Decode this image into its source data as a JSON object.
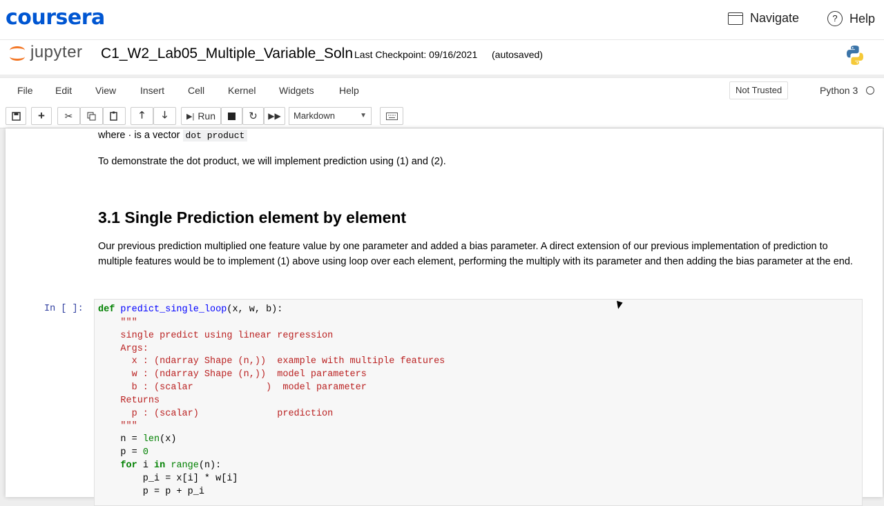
{
  "coursera": {
    "logo": "coursera",
    "navigate_label": "Navigate",
    "help_label": "Help",
    "navigate_icon": "window-icon",
    "help_icon": "question-circle-icon",
    "brand_color": "#0056d2"
  },
  "jupyter": {
    "logo_text": "jupyter",
    "notebook_title": "C1_W2_Lab05_Multiple_Variable_Soln",
    "checkpoint": "Last Checkpoint: 09/16/2021",
    "autosaved": "(autosaved)",
    "logo_color": "#f37726"
  },
  "menubar": {
    "items": [
      "File",
      "Edit",
      "View",
      "Insert",
      "Cell",
      "Kernel",
      "Widgets",
      "Help"
    ],
    "trust_label": "Not Trusted",
    "kernel_name": "Python 3"
  },
  "toolbar": {
    "run_label": "Run",
    "cell_type": "Markdown",
    "icons": [
      "save-icon",
      "add-cell-icon",
      "cut-icon",
      "copy-icon",
      "paste-icon",
      "move-up-icon",
      "move-down-icon",
      "run-icon",
      "stop-icon",
      "restart-icon",
      "fast-forward-icon",
      "keyboard-icon"
    ]
  },
  "notebook": {
    "line1_pre": "where · is a vector",
    "line1_code": "dot product",
    "line2": "To demonstrate the dot product, we will implement prediction using (1) and (2).",
    "heading": "3.1 Single Prediction element by element",
    "paragraph": "Our previous prediction multiplied one feature value by one parameter and added a bias parameter. A direct extension of our previous implementation of prediction to multiple features would be to implement (1) above using loop over each element, performing the multiply with its parameter and then adding the bias parameter at the end.",
    "prompt": "In [ ]:",
    "code": {
      "l1_kw": "def",
      "l1_fn": "predict_single_loop",
      "l1_rest": "(x, w, b):",
      "l2": "    \"\"\"",
      "l3": "    single predict using linear regression",
      "l4": "    Args:",
      "l5": "      x : (ndarray Shape (n,))  example with multiple features",
      "l6": "      w : (ndarray Shape (n,))  model parameters",
      "l7": "      b : (scalar             )  model parameter",
      "l8": "    Returns",
      "l9": "      p : (scalar)              prediction",
      "l10": "    \"\"\"",
      "l11_pre": "    n = ",
      "l11_bi": "len",
      "l11_post": "(x)",
      "l12_pre": "    p = ",
      "l12_num": "0",
      "l13_pre": "    ",
      "l13_kw": "for",
      "l13_mid": " i ",
      "l13_in": "in",
      "l13_sp": " ",
      "l13_bi": "range",
      "l13_post": "(n):",
      "l14": "        p_i = x[i] * w[i]",
      "l15": "        p = p + p_i"
    }
  }
}
